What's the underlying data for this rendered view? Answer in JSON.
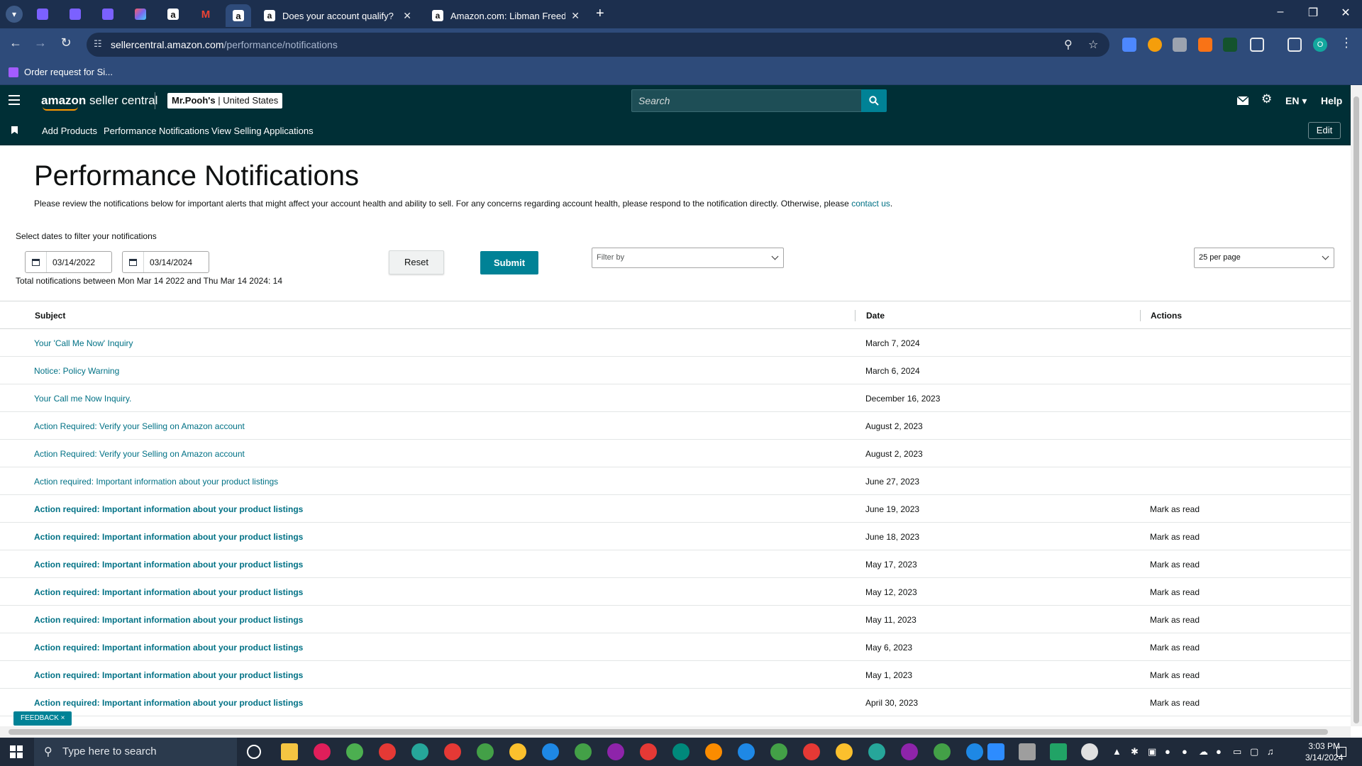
{
  "browser": {
    "tabs": [
      {
        "title": "Does your account qualify?",
        "active": false
      },
      {
        "title": "Amazon.com: Libman Freedom",
        "active": false
      }
    ],
    "new_tab_label": "+",
    "url_host": "sellercentral.amazon.com",
    "url_path": "/performance/notifications",
    "bookmark": "Order request for Si...",
    "profile_initial": "O",
    "gmail_glyph": "M",
    "amazon_glyph": "a"
  },
  "header": {
    "logo_primary": "amazon",
    "logo_secondary": " seller central",
    "account_name": "Mr.Pooh's",
    "account_region": " | United States",
    "search_placeholder": "Search",
    "language": "EN",
    "help": "Help"
  },
  "nav": {
    "items": [
      "Add Products",
      "Performance Notifications",
      "View Selling Applications"
    ],
    "edit": "Edit"
  },
  "page": {
    "title": "Performance Notifications",
    "intro": "Please review the notifications below for important alerts that might affect your account health and ability to sell. For any concerns regarding account health, please respond to the notification directly. Otherwise, please ",
    "intro_link": "contact us",
    "intro_end": ".",
    "filter_label": "Select dates to filter your notifications",
    "start_date": "03/14/2022",
    "end_date": "03/14/2024",
    "total": "Total notifications between Mon Mar 14 2022 and Thu Mar 14 2024: 14",
    "reset": "Reset",
    "submit": "Submit",
    "filter_by": "Filter by",
    "per_page": "25 per page",
    "feedback": "FEEDBACK ×"
  },
  "table": {
    "headers": {
      "subject": "Subject",
      "date": "Date",
      "actions": "Actions"
    },
    "rows": [
      {
        "subject": "Your 'Call Me Now' Inquiry",
        "date": "March 7, 2024",
        "action": "",
        "unread": false
      },
      {
        "subject": "Notice: Policy Warning",
        "date": "March 6, 2024",
        "action": "",
        "unread": false
      },
      {
        "subject": "Your Call me Now Inquiry.",
        "date": "December 16, 2023",
        "action": "",
        "unread": false
      },
      {
        "subject": "Action Required: Verify your Selling on Amazon account",
        "date": "August 2, 2023",
        "action": "",
        "unread": false
      },
      {
        "subject": "Action Required: Verify your Selling on Amazon account",
        "date": "August 2, 2023",
        "action": "",
        "unread": false
      },
      {
        "subject": "Action required: Important information about your product listings",
        "date": "June 27, 2023",
        "action": "",
        "unread": false
      },
      {
        "subject": "Action required: Important information about your product listings",
        "date": "June 19, 2023",
        "action": "Mark as read",
        "unread": true
      },
      {
        "subject": "Action required: Important information about your product listings",
        "date": "June 18, 2023",
        "action": "Mark as read",
        "unread": true
      },
      {
        "subject": "Action required: Important information about your product listings",
        "date": "May 17, 2023",
        "action": "Mark as read",
        "unread": true
      },
      {
        "subject": "Action required: Important information about your product listings",
        "date": "May 12, 2023",
        "action": "Mark as read",
        "unread": true
      },
      {
        "subject": "Action required: Important information about your product listings",
        "date": "May 11, 2023",
        "action": "Mark as read",
        "unread": true
      },
      {
        "subject": "Action required: Important information about your product listings",
        "date": "May 6, 2023",
        "action": "Mark as read",
        "unread": true
      },
      {
        "subject": "Action required: Important information about your product listings",
        "date": "May 1, 2023",
        "action": "Mark as read",
        "unread": true
      },
      {
        "subject": "Action required: Important information about your product listings",
        "date": "April 30, 2023",
        "action": "Mark as read",
        "unread": true
      }
    ]
  },
  "taskbar": {
    "search_placeholder": "Type here to search",
    "time": "3:03 PM",
    "date": "3/14/2024"
  },
  "colors": {
    "header_bg": "#002f36",
    "accent": "#008296",
    "link": "#007185",
    "browser_frame": "#2e4b7a"
  }
}
